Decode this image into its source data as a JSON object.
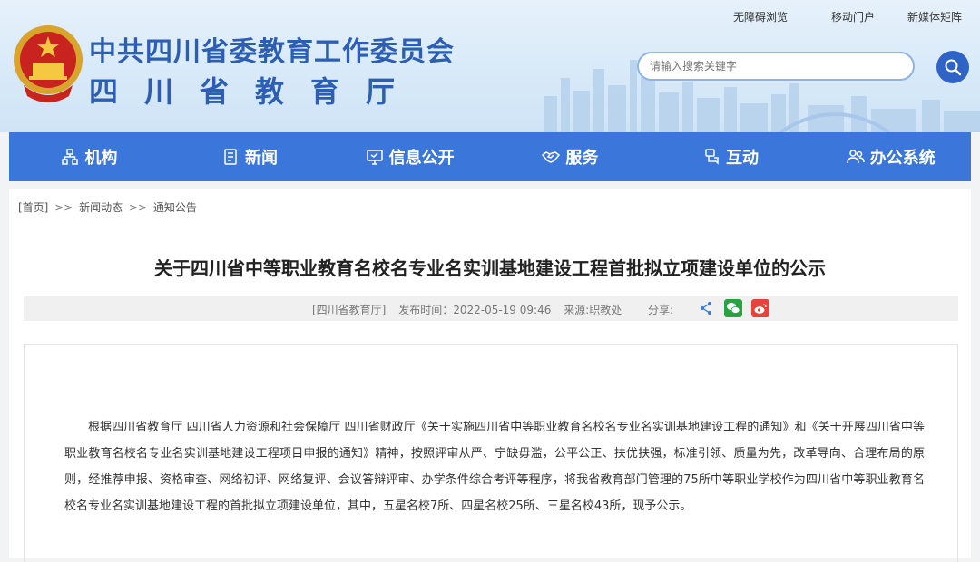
{
  "header": {
    "title_cn": "中共四川省委教育工作委员会",
    "title_dept": "四川省教育厅",
    "toplinks": [
      "无障碍浏览",
      "移动门户",
      "新媒体矩阵"
    ],
    "search_placeholder": "请输入搜索关键字"
  },
  "nav": {
    "items": [
      {
        "label": "机构",
        "icon": "org-icon"
      },
      {
        "label": "新闻",
        "icon": "news-icon"
      },
      {
        "label": "信息公开",
        "icon": "monitor-icon"
      },
      {
        "label": "服务",
        "icon": "handshake-icon"
      },
      {
        "label": "互动",
        "icon": "chat-icon"
      },
      {
        "label": "办公系统",
        "icon": "users-icon"
      }
    ]
  },
  "breadcrumb": {
    "home": "[首页]",
    "sep": ">>",
    "level1": "新闻动态",
    "level2": "通知公告"
  },
  "article": {
    "title": "关于四川省中等职业教育名校名专业名实训基地建设工程首批拟立项建设单位的公示",
    "meta_source_tag": "[四川省教育厅]",
    "meta_time": "发布时间：2022-05-19 09:46",
    "meta_from": "来源:职教处",
    "share_label": "分享:",
    "body": "根据四川省教育厅 四川省人力资源和社会保障厅 四川省财政厅《关于实施四川省中等职业教育名校名专业名实训基地建设工程的通知》和《关于开展四川省中等职业教育名校名专业名实训基地建设工程项目申报的通知》精神，按照评审从严、宁缺毋滥，公平公正、扶优扶强，标准引领、质量为先，改革导向、合理布局的原则，经推荐申报、资格审查、网络初评、网络复评、会议答辩评审、办学条件综合考评等程序，将我省教育部门管理的75所中等职业学校作为四川省中等职业教育名校名专业名实训基地建设工程的首批拟立项建设单位，其中，五星名校7所、四星名校25所、三星名校43所，现予公示。"
  },
  "colors": {
    "nav_bg": "#3b76db",
    "title_blue": "#2c5fb3",
    "wechat_green": "#29a33f",
    "weibo_red": "#e6443b"
  }
}
